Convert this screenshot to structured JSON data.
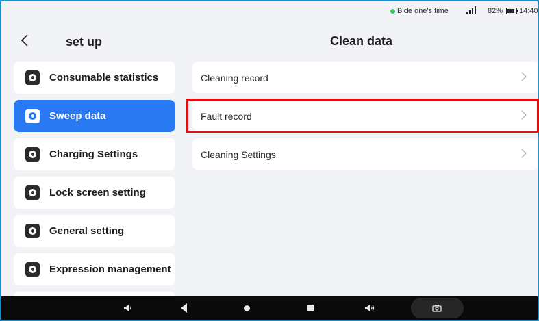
{
  "status_bar": {
    "status_text": "Bide one's time",
    "battery": "82%",
    "time": "14:40"
  },
  "header": {
    "sidebar_title": "set up",
    "main_title": "Clean data"
  },
  "sidebar": {
    "items": [
      {
        "label": "Consumable statistics",
        "active": false
      },
      {
        "label": "Sweep data",
        "active": true
      },
      {
        "label": "Charging Settings",
        "active": false
      },
      {
        "label": "Lock screen setting",
        "active": false
      },
      {
        "label": "General setting",
        "active": false
      },
      {
        "label": "Expression management",
        "active": false
      }
    ]
  },
  "main": {
    "rows": [
      {
        "label": "Cleaning record"
      },
      {
        "label": "Fault record"
      },
      {
        "label": "Cleaning Settings"
      }
    ]
  },
  "colors": {
    "accent": "#2979f2",
    "highlight": "#e01010",
    "status_dot": "#3cc463"
  },
  "icons": {
    "back": "chevron-left-icon",
    "sidebar_item": "gear-icon",
    "row_chevron": "chevron-right-icon",
    "nav": [
      "volume-down-icon",
      "back-icon",
      "home-icon",
      "recent-apps-icon",
      "volume-up-icon",
      "camera-icon"
    ]
  }
}
